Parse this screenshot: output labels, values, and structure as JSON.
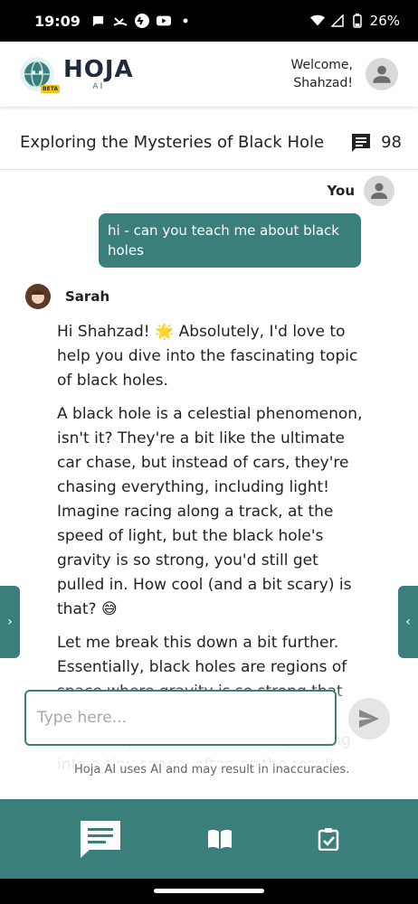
{
  "status_bar": {
    "time": "19:09",
    "battery": "26%"
  },
  "header": {
    "logo_text": "HOJA",
    "logo_sub": "AI",
    "beta_badge": "BETA",
    "welcome_line1": "Welcome,",
    "welcome_line2": "Shahzad!"
  },
  "conversation": {
    "title": "Exploring the Mysteries of Black Hole",
    "message_count": "98"
  },
  "chat": {
    "user_label": "You",
    "user_message": "hi - can you teach me about black holes",
    "bot_name": "Sarah",
    "bot_paragraphs": [
      "Hi Shahzad! 🌟 Absolutely, I'd love to help you dive into the fascinating topic of black holes.",
      "A black hole is a celestial phenomenon, isn't it? They're a bit like the ultimate car chase, but instead of cars, they're chasing everything, including light! Imagine racing along a track, at the speed of light, but the black hole's gravity is so strong, you'd still get pulled in. How cool (and a bit scary) is that? 😅",
      "Let me break this down a bit further. Essentially, black holes are regions of space where gravity is so strong that nothing, not even light, can escape from the point of no return, squeezing into a tiny space, often as the result"
    ]
  },
  "input": {
    "placeholder": "Type here...",
    "disclaimer": "Hoja AI uses AI and may result in inaccuracies."
  },
  "nav": {
    "items": [
      "chat-icon",
      "book-icon",
      "clipboard-check-icon"
    ]
  },
  "colors": {
    "accent": "#3b7f7c",
    "bubble": "#3b7f7c"
  }
}
